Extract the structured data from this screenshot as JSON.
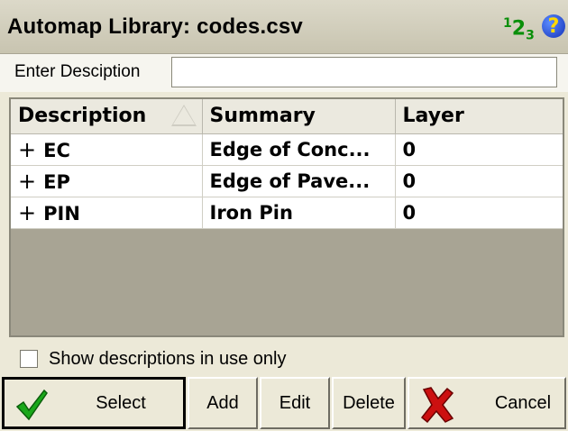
{
  "window": {
    "title": "Automap Library: codes.csv",
    "input_mode_icon": "123-input-mode-icon",
    "help_icon": "help-icon",
    "help_glyph": "?"
  },
  "search": {
    "label": "Enter Desciption",
    "value": ""
  },
  "table": {
    "columns": [
      "Description",
      "Summary",
      "Layer"
    ],
    "sort_icon": "sort-ascending-icon",
    "rows": [
      {
        "description": "EC",
        "summary": "Edge of Conc...",
        "layer": "0",
        "expand_glyph": "+"
      },
      {
        "description": "EP",
        "summary": "Edge of Pave...",
        "layer": "0",
        "expand_glyph": "+"
      },
      {
        "description": "PIN",
        "summary": "Iron Pin",
        "layer": "0",
        "expand_glyph": "+"
      }
    ]
  },
  "filter": {
    "label": "Show descriptions in use only",
    "checked": false
  },
  "buttons": {
    "select": "Select",
    "add": "Add",
    "edit": "Edit",
    "delete": "Delete",
    "cancel": "Cancel"
  },
  "colors": {
    "input_mode": "#0a8f0a",
    "help": "#1432b8",
    "check_green": "#1aa81a",
    "cancel_red": "#cc1010"
  }
}
